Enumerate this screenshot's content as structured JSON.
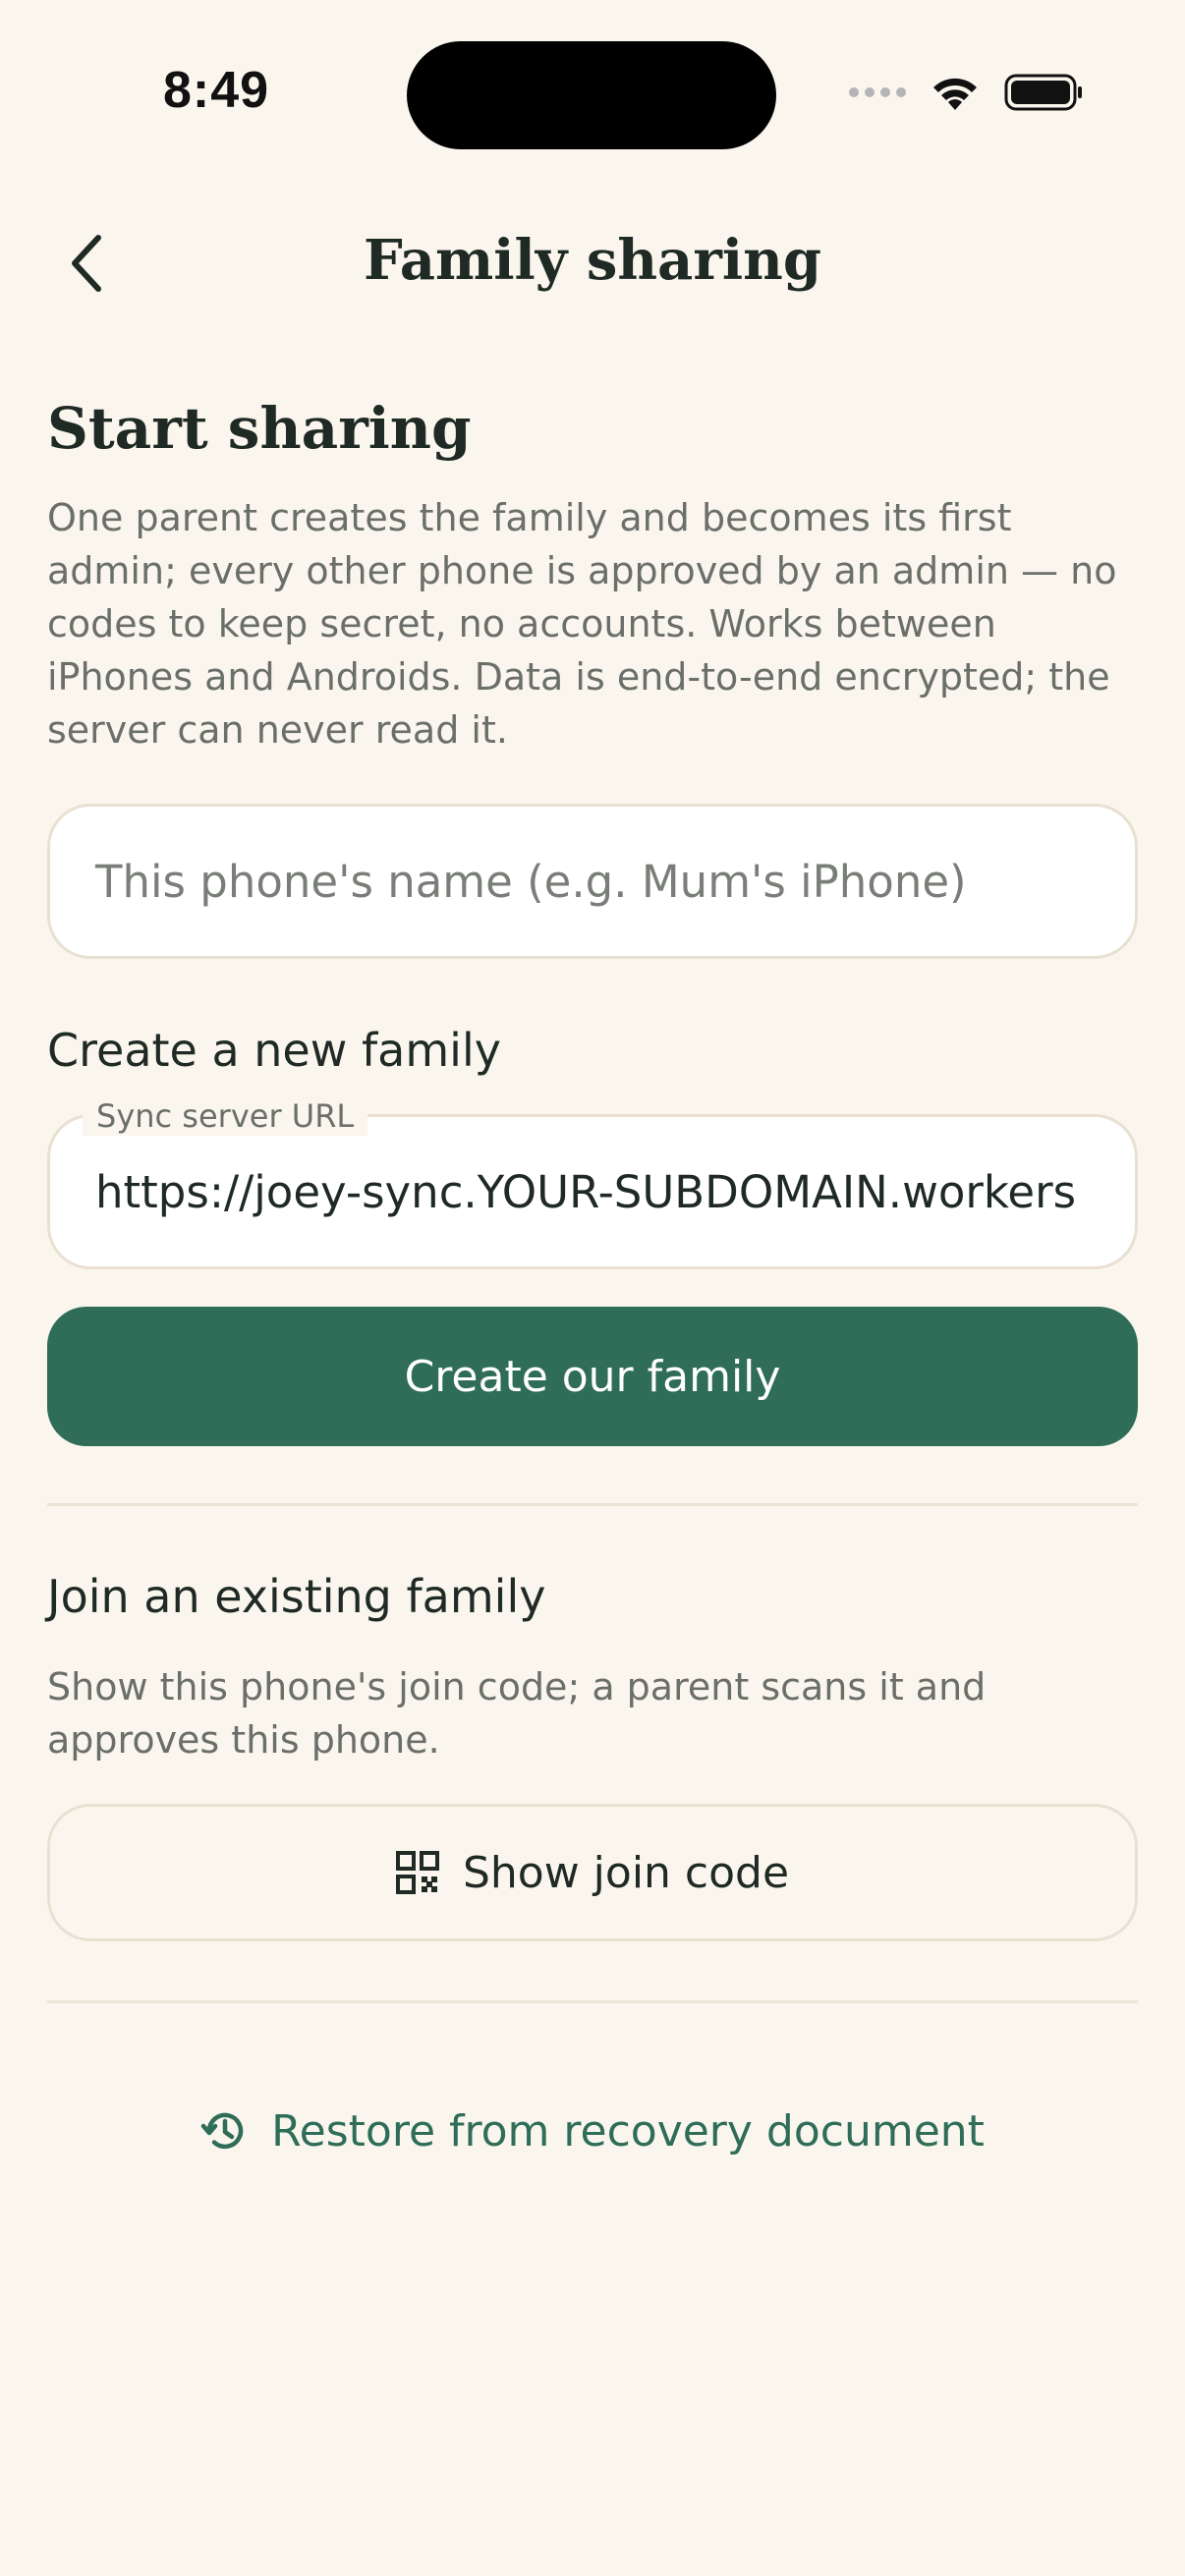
{
  "status_bar": {
    "time": "8:49"
  },
  "header": {
    "title": "Family sharing",
    "back_icon": "chevron-left-icon"
  },
  "start_sharing": {
    "heading": "Start sharing",
    "description": "One parent creates the family and becomes its first admin; every other phone is approved by an admin — no codes to keep secret, no accounts. Works between iPhones and Androids. Data is end-to-end encrypted; the server can never read it.",
    "name_input": {
      "placeholder": "This phone's name (e.g. Mum's iPhone)",
      "value": ""
    }
  },
  "create_family": {
    "heading": "Create a new family",
    "url_label": "Sync server URL",
    "url_value": "https://joey-sync.YOUR-SUBDOMAIN.workers",
    "button_label": "Create our family"
  },
  "join_family": {
    "heading": "Join an existing family",
    "description": "Show this phone's join code; a parent scans it and approves this phone.",
    "button_label": "Show join code",
    "button_icon": "qr-code-icon"
  },
  "restore": {
    "label": "Restore from recovery document",
    "icon": "history-icon"
  },
  "colors": {
    "background": "#faf6ee",
    "primary": "#2f6d58",
    "text": "#1f2a24",
    "muted": "#6b6f69",
    "border": "#e8e1d2"
  }
}
